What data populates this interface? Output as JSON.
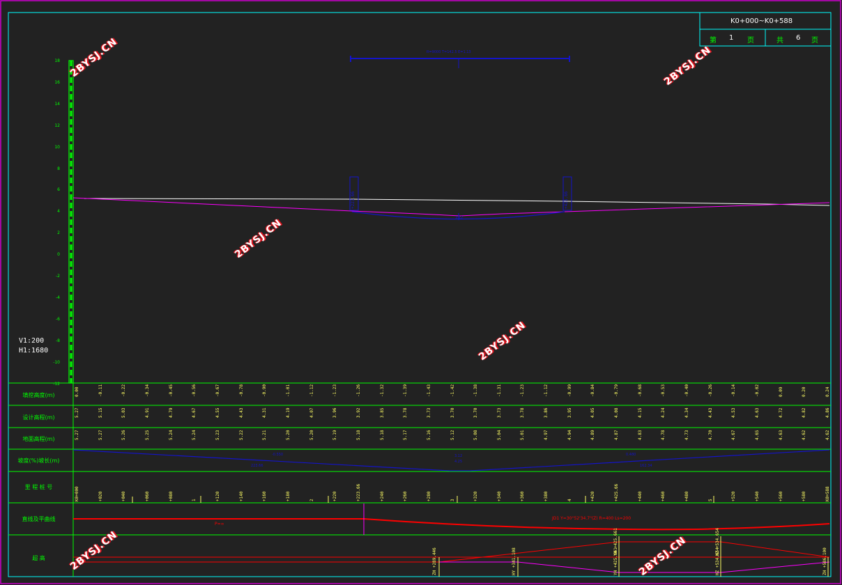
{
  "title_block": {
    "range": "K0+000~K0+588",
    "sheet_prefix": "第",
    "sheet_no": "1",
    "sheet_unit": "页",
    "total_prefix": "共",
    "total_no": "6",
    "total_unit": "页"
  },
  "scale": {
    "vertical": "V1:200",
    "horizontal": "H1:1680"
  },
  "y_axis_labels": [
    "18",
    "16",
    "14",
    "12",
    "10",
    "8",
    "6",
    "4",
    "2",
    "0",
    "-2",
    "-4",
    "-6",
    "-8",
    "-10",
    "-12"
  ],
  "curve_label": "R=9000 T=142.5 E=1.13",
  "curve_label_short": "E",
  "pvi_labels": {
    "left": "+223.66",
    "right": "+425.66",
    "bottom": "3.12"
  },
  "row_labels": {
    "cut_fill": "填挖高度(m)",
    "design_elev": "设计高程(m)",
    "ground_elev": "地面高程(m)",
    "grade": "坡度(%)坡长(m)",
    "stations": "里 程 桩 号",
    "alignment": "直线及平曲线",
    "superelevation": "超 高"
  },
  "cut_fill": [
    "0.00",
    "-0.11",
    "-0.22",
    "-0.34",
    "-0.45",
    "-0.56",
    "-0.67",
    "-0.78",
    "-0.90",
    "-1.01",
    "-1.12",
    "-1.23",
    "-1.26",
    "-1.32",
    "-1.39",
    "-1.43",
    "-1.42",
    "-1.38",
    "-1.31",
    "-1.23",
    "-1.12",
    "-0.99",
    "-0.84",
    "-0.79",
    "-0.68",
    "-0.53",
    "-0.40",
    "-0.26",
    "-0.14",
    "-0.02",
    "0.09",
    "0.20",
    "0.24"
  ],
  "design_elev": [
    "5.27",
    "5.15",
    "5.03",
    "4.91",
    "4.79",
    "4.67",
    "4.55",
    "4.43",
    "4.31",
    "4.19",
    "4.07",
    "3.96",
    "3.92",
    "3.85",
    "3.78",
    "3.73",
    "3.70",
    "3.70",
    "3.73",
    "3.78",
    "3.86",
    "3.95",
    "4.05",
    "4.08",
    "4.15",
    "4.24",
    "4.34",
    "4.43",
    "4.53",
    "4.63",
    "4.72",
    "4.82",
    "4.86"
  ],
  "ground_elev": [
    "5.27",
    "5.27",
    "5.26",
    "5.25",
    "5.24",
    "5.24",
    "5.23",
    "5.22",
    "5.21",
    "5.20",
    "5.20",
    "5.19",
    "5.18",
    "5.18",
    "5.17",
    "5.16",
    "5.12",
    "5.08",
    "5.04",
    "5.01",
    "4.97",
    "4.94",
    "4.89",
    "4.87",
    "4.83",
    "4.78",
    "4.73",
    "4.70",
    "4.67",
    "4.65",
    "4.63",
    "4.62",
    "4.62"
  ],
  "grade_labels": {
    "left_top": "-0.550",
    "left_bottom": "223.66",
    "mid_top": "3.12",
    "mid_bottom": "4.25",
    "right_top": "0.480",
    "right_bottom": "162.34"
  },
  "stations": [
    "K0+000",
    "+020",
    "+040",
    "+060",
    "+080",
    "1",
    "+120",
    "+140",
    "+160",
    "+180",
    "2",
    "+220",
    "+223.66",
    "+240",
    "+260",
    "+280",
    "3",
    "+320",
    "+340",
    "+360",
    "+380",
    "4",
    "+420",
    "+425.66",
    "+440",
    "+460",
    "+480",
    "5",
    "+520",
    "+540",
    "+560",
    "+580",
    "K0+588"
  ],
  "alignment": {
    "straight": "P=∞",
    "curve": "JD1  Y=30°52'34.7\"(Z)  R=400  Ls=200"
  },
  "superelevation": {
    "ts": "ZH\n+289.446",
    "sc": "HY\n+341.108",
    "mid_l": "YH\n+425.661",
    "mid_r": "HZ\n+534.654",
    "top_l": "YH\n+425.661",
    "top_r": "HZ\n+534.654",
    "end": "ZH\n+586.100"
  },
  "watermark": "2BYSJ.CN",
  "colors": {
    "background": "#222222",
    "grid": "#00ff00",
    "frame": "#cc00cc",
    "table_border": "#00ffff",
    "design_line": "#ff00ff",
    "ground_line": "#ffffff",
    "labels_blue": "#1414c8",
    "alignment_red": "#ff0000",
    "station_yellow": "#ffff66"
  }
}
